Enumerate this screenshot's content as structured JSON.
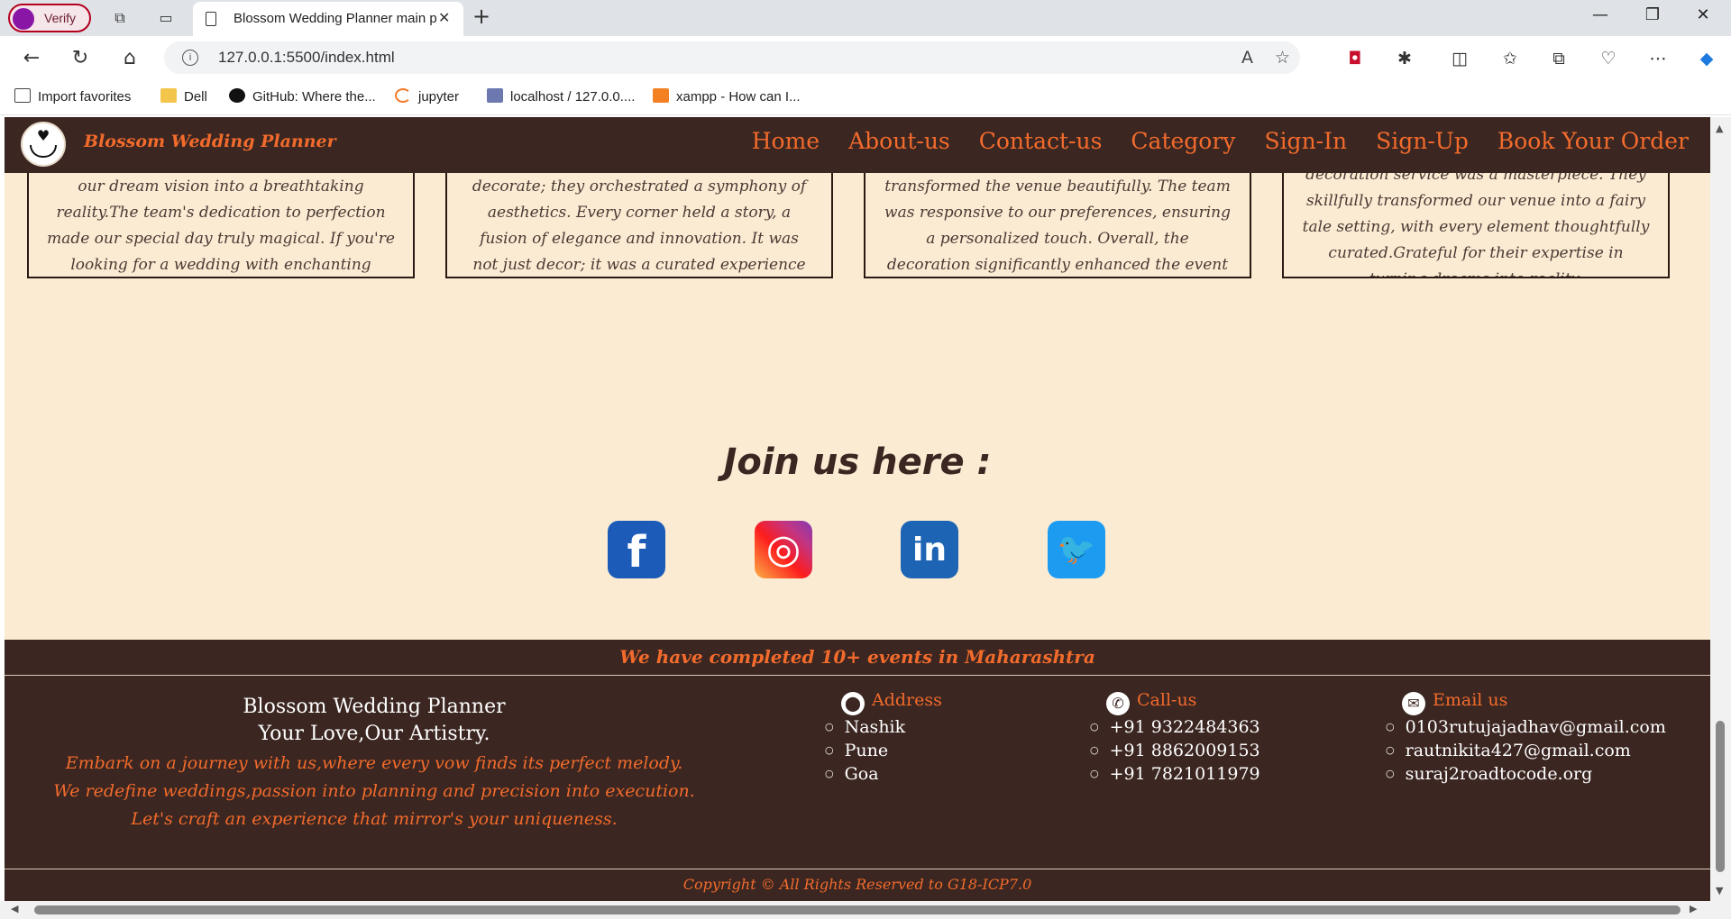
{
  "browser": {
    "verify_label": "Verify",
    "tab_title": "Blossom Wedding Planner main page",
    "url": "127.0.0.1:5500/index.html",
    "bookmarks": [
      {
        "label": "Import favorites",
        "icon": "import-icon"
      },
      {
        "label": "Dell",
        "icon": "folder-icon"
      },
      {
        "label": "GitHub: Where the...",
        "icon": "github-icon"
      },
      {
        "label": "jupyter",
        "icon": "jupyter-icon"
      },
      {
        "label": "localhost / 127.0.0....",
        "icon": "phpmyadmin-icon"
      },
      {
        "label": "xampp - How can I...",
        "icon": "stackoverflow-icon"
      }
    ]
  },
  "site": {
    "brand": "Blossom Wedding Planner",
    "nav": [
      "Home",
      "About-us",
      "Contact-us",
      "Category",
      "Sign-In",
      "Sign-Up",
      "Book Your Order"
    ],
    "reviews": [
      {
        "text": "our dream vision into a breathtaking reality.The team's dedication to perfection made our special day truly magical. If you're looking for a wedding with enchanting decor, this company is a stellar choice.",
        "stars": "★★★★★"
      },
      {
        "text": "decorate; they orchestrated a symphony of aesthetics. Every corner held a story, a fusion of elegance and innovation. It was not just decor; it was a curated experience that left an indelible mark on our memories.",
        "stars": "★★★★☆"
      },
      {
        "text": "transformed the venue beautifully. The team was responsive to our preferences, ensuring a personalized touch. Overall, the decoration significantly enhanced the event ambiance, and we were delighted with the outcome.",
        "stars": "★★★★★"
      },
      {
        "text": "decoration service was a masterpiece. They skillfully transformed our venue into a fairy tale setting, with every element thoughtfully curated.Grateful for their expertise in turning dreams into reality.",
        "stars": "★★★★☆"
      }
    ],
    "join_title": "Join us here :",
    "socials": [
      {
        "name": "facebook-icon",
        "glyph": "f"
      },
      {
        "name": "instagram-icon",
        "glyph": "◎"
      },
      {
        "name": "linkedin-icon",
        "glyph": "in"
      },
      {
        "name": "twitter-icon",
        "glyph": "🐦"
      }
    ],
    "banner": "We have completed 10+ events in Maharashtra",
    "footer": {
      "name": "Blossom Wedding Planner",
      "tagline": "Your Love,Our Artistry.",
      "desc": [
        "Embark on a journey with us,where every vow finds its perfect melody.",
        "We redefine weddings,passion into planning and precision into execution.",
        "Let's craft an experience that mirror's your uniqueness."
      ],
      "address": {
        "title": "Address",
        "items": [
          "Nashik",
          "Pune",
          "Goa"
        ]
      },
      "call": {
        "title": "Call-us",
        "items": [
          "+91 9322484363",
          "+91 8862009153",
          "+91 7821011979"
        ]
      },
      "email": {
        "title": "Email us",
        "items": [
          "0103rutujajadhav@gmail.com",
          "rautnikita427@gmail.com",
          "suraj2roadtocode.org"
        ]
      },
      "copyright": "Copyright © All Rights Reserved to G18-ICP7.0"
    }
  },
  "colors": {
    "accent": "#f26b2c",
    "dark": "#3b2621",
    "cream": "#fbebd3"
  }
}
